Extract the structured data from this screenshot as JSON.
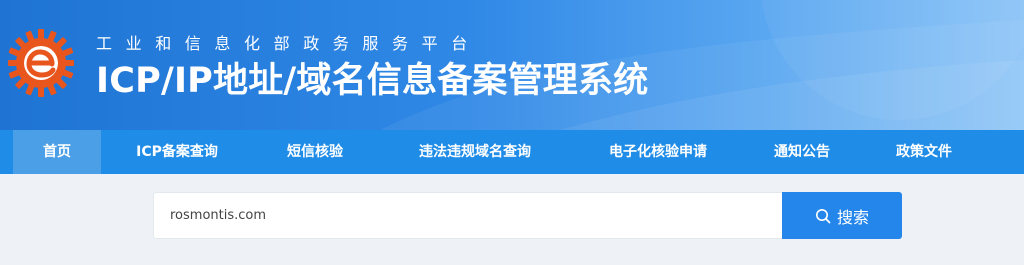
{
  "header": {
    "subtitle": "工业和信息化部政务服务平台",
    "title": "ICP/IP地址/域名信息备案管理系统",
    "logo_icon": "ministry-gear-logo",
    "colors": {
      "banner": "#1f74d3",
      "logo_orange": "#e8561e"
    }
  },
  "nav": {
    "items": [
      {
        "label": "首页",
        "active": true
      },
      {
        "label": "ICP备案查询",
        "active": false
      },
      {
        "label": "短信核验",
        "active": false
      },
      {
        "label": "违法违规域名查询",
        "active": false
      },
      {
        "label": "电子化核验申请",
        "active": false
      },
      {
        "label": "通知公告",
        "active": false
      },
      {
        "label": "政策文件",
        "active": false
      }
    ],
    "colors": {
      "bar": "#1f8ce8",
      "active": "#4a9fe6"
    }
  },
  "search": {
    "value": "rosmontis.com",
    "placeholder": "",
    "button_label": "搜索",
    "button_icon": "search-icon",
    "colors": {
      "button": "#2486ea"
    }
  }
}
